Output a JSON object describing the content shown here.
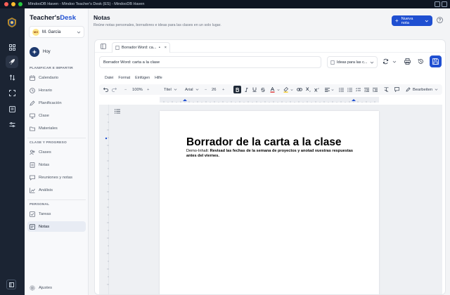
{
  "window": {
    "title": "MindooDB Haven - Mindoo Teacher's Desk (ES) - MindooDB Haven"
  },
  "brand": {
    "part1": "Teacher's",
    "part2": "Desk"
  },
  "user": {
    "initials": "MG",
    "name": "M. García"
  },
  "sidebar": {
    "today": "Hoy",
    "section1": "PLANIFICAR E IMPARTIR",
    "section1_items": [
      {
        "label": "Calendario",
        "icon": "calendar-icon"
      },
      {
        "label": "Horario",
        "icon": "clock-icon"
      },
      {
        "label": "Planificación",
        "icon": "pen-icon"
      },
      {
        "label": "Clase",
        "icon": "monitor-icon"
      },
      {
        "label": "Materiales",
        "icon": "folder-icon"
      }
    ],
    "section2": "CLASE Y PROGRESO",
    "section2_items": [
      {
        "label": "Clases",
        "icon": "people-icon"
      },
      {
        "label": "Notas",
        "icon": "doc-icon"
      },
      {
        "label": "Reuniones y notas",
        "icon": "chat-icon"
      },
      {
        "label": "Análisis",
        "icon": "chart-icon"
      }
    ],
    "section3": "PERSONAL",
    "section3_items": [
      {
        "label": "Tareas",
        "icon": "checkbox-icon"
      },
      {
        "label": "Notas",
        "icon": "note-icon",
        "active": true
      }
    ],
    "settings": "Ajustes"
  },
  "header": {
    "title": "Notas",
    "subtitle": "Reúne notas personales, borradores e ideas para las clases en un solo lugar.",
    "new_button": "Nueva nota"
  },
  "editor": {
    "tab_title": "Borrador Word: ca...",
    "tab_dot": "•",
    "tab_close": "×",
    "name_value": "Borrador Word: carta a la clase",
    "destination": "Ideas para las c...",
    "menu": [
      "Datei",
      "Format",
      "Einfügen",
      "Hilfe"
    ],
    "zoom": "100%",
    "style": "Titel",
    "font": "Arial",
    "font_size": "26",
    "edit_mode": "Bearbeiten"
  },
  "document": {
    "heading": "Borrador de la carta a la clase",
    "label": "Demo-Inhalt:",
    "body": "Revisad las fechas de la semana de proyectos y anotad vuestras respuestas antes del viernes."
  },
  "colors": {
    "accent": "#1f4fd1",
    "rail": "#1b2433",
    "text_color_underline": "#dc2626",
    "highlight_underline": "#facc15"
  }
}
